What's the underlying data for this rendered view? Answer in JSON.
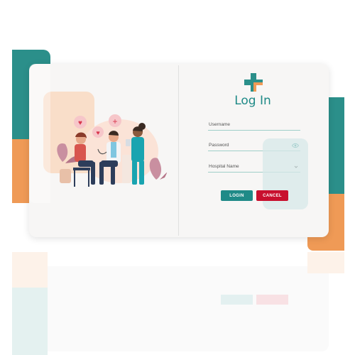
{
  "login": {
    "title": "Log In",
    "username_placeholder": "Username",
    "password_placeholder": "Password",
    "hospital_placeholder": "Hospital Name",
    "login_button": "LOGIN",
    "cancel_button": "CANCEL"
  },
  "colors": {
    "brand_teal": "#1f8a87",
    "cancel_red": "#c8102e",
    "accent_orange": "#ef9a56"
  },
  "icons": {
    "logo": "medical-cross-icon",
    "password_toggle": "eye-icon",
    "hospital_dropdown": "chevron-down-icon",
    "illustration": "doctor-patient-illustration"
  }
}
